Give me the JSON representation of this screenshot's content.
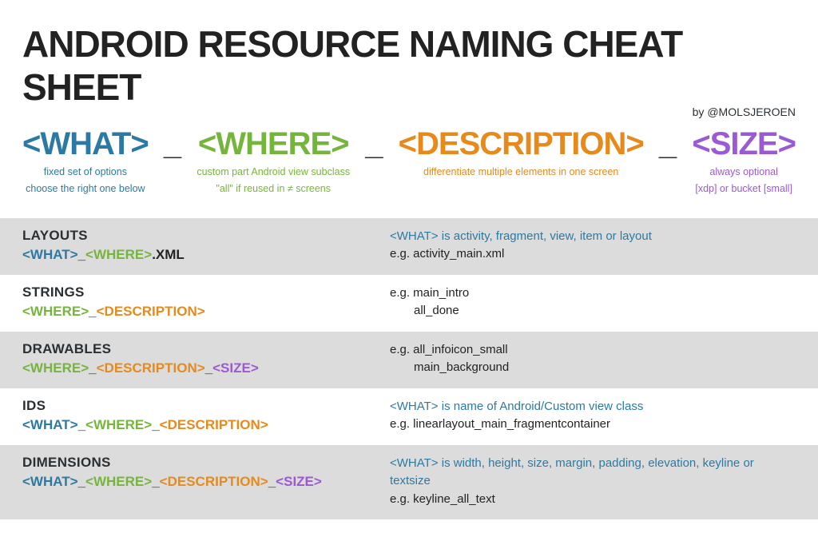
{
  "title": "ANDROID RESOURCE NAMING CHEAT SHEET",
  "byline": "by @MOLSJEROEN",
  "tokens": {
    "what": "<WHAT>",
    "where": "<WHERE>",
    "desc": "<DESCRIPTION>",
    "size": "<SIZE>",
    "sep": "_"
  },
  "subs": {
    "what_l1": "fixed set of options",
    "what_l2": "choose the right one below",
    "where_l1": "custom part Android view subclass",
    "where_l2": "\"all\" if reused in ≠ screens",
    "desc_l1": "differentiate multiple elements in one screen",
    "size_l1": "always optional",
    "size_l2": "[xdp] or bucket [small]"
  },
  "rows": {
    "layouts": {
      "label": "LAYOUTS",
      "ext": ".XML",
      "hint": "<WHAT> is activity, fragment, view, item or layout",
      "eg": "e.g. activity_main.xml"
    },
    "strings": {
      "label": "STRINGS",
      "eg1": "e.g. main_intro",
      "eg2": "all_done"
    },
    "drawables": {
      "label": "DRAWABLES",
      "eg1": "e.g. all_infoicon_small",
      "eg2": "main_background"
    },
    "ids": {
      "label": "IDS",
      "hint": "<WHAT> is name of Android/Custom view class",
      "eg": "e.g. linearlayout_main_fragmentcontainer"
    },
    "dimensions": {
      "label": "DIMENSIONS",
      "hint": "<WHAT> is width, height, size, margin, padding, elevation, keyline or textsize",
      "eg": "e.g. keyline_all_text"
    }
  }
}
